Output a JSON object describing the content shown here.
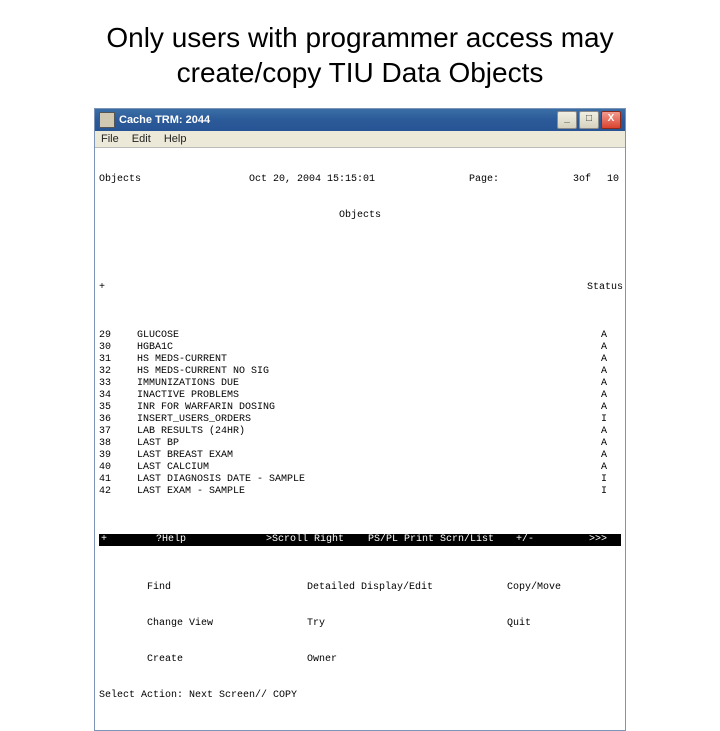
{
  "slide": {
    "title": "Only users with programmer access may create/copy TIU  Data Objects"
  },
  "window": {
    "title": "Cache TRM: 2044",
    "minimize": "_",
    "maximize": "□",
    "close": "X"
  },
  "menubar": {
    "file": "File",
    "edit": "Edit",
    "help": "Help"
  },
  "header": {
    "left": "Objects",
    "datetime": "Oct 20, 2004 15:15:01",
    "page_label": "Page:",
    "page_cur": "3",
    "page_of": "of",
    "page_total": "10",
    "subtitle": "Objects"
  },
  "status_hdr": "Status",
  "plus": "+",
  "rows": [
    {
      "num": "29",
      "name": "GLUCOSE",
      "status": "A"
    },
    {
      "num": "30",
      "name": "HGBA1C",
      "status": "A"
    },
    {
      "num": "31",
      "name": "HS MEDS-CURRENT",
      "status": "A"
    },
    {
      "num": "32",
      "name": "HS MEDS-CURRENT NO SIG",
      "status": "A"
    },
    {
      "num": "33",
      "name": "IMMUNIZATIONS DUE",
      "status": "A"
    },
    {
      "num": "34",
      "name": "INACTIVE PROBLEMS",
      "status": "A"
    },
    {
      "num": "35",
      "name": "INR FOR WARFARIN DOSING",
      "status": "A"
    },
    {
      "num": "36",
      "name": "INSERT_USERS_ORDERS",
      "status": "I"
    },
    {
      "num": "37",
      "name": "LAB RESULTS (24HR)",
      "status": "A"
    },
    {
      "num": "38",
      "name": "LAST BP",
      "status": "A"
    },
    {
      "num": "39",
      "name": "LAST BREAST EXAM",
      "status": "A"
    },
    {
      "num": "40",
      "name": "LAST CALCIUM",
      "status": "A"
    },
    {
      "num": "41",
      "name": "LAST DIAGNOSIS DATE - SAMPLE",
      "status": "I"
    },
    {
      "num": "42",
      "name": "LAST EXAM - SAMPLE",
      "status": "I"
    }
  ],
  "cmdbar": {
    "plus": "+",
    "help": "?Help",
    "scroll": ">Scroll Right",
    "print": "PS/PL Print Scrn/List",
    "toggle": "+/-",
    "more": ">>>"
  },
  "commands": {
    "r1c1": "Find",
    "r1c2": "Detailed Display/Edit",
    "r1c3": "Copy/Move",
    "r2c1": "Change View",
    "r2c2": "Try",
    "r2c3": "Quit",
    "r3c1": "Create",
    "r3c2": "Owner"
  },
  "prompt": "Select Action: Next Screen// COPY"
}
